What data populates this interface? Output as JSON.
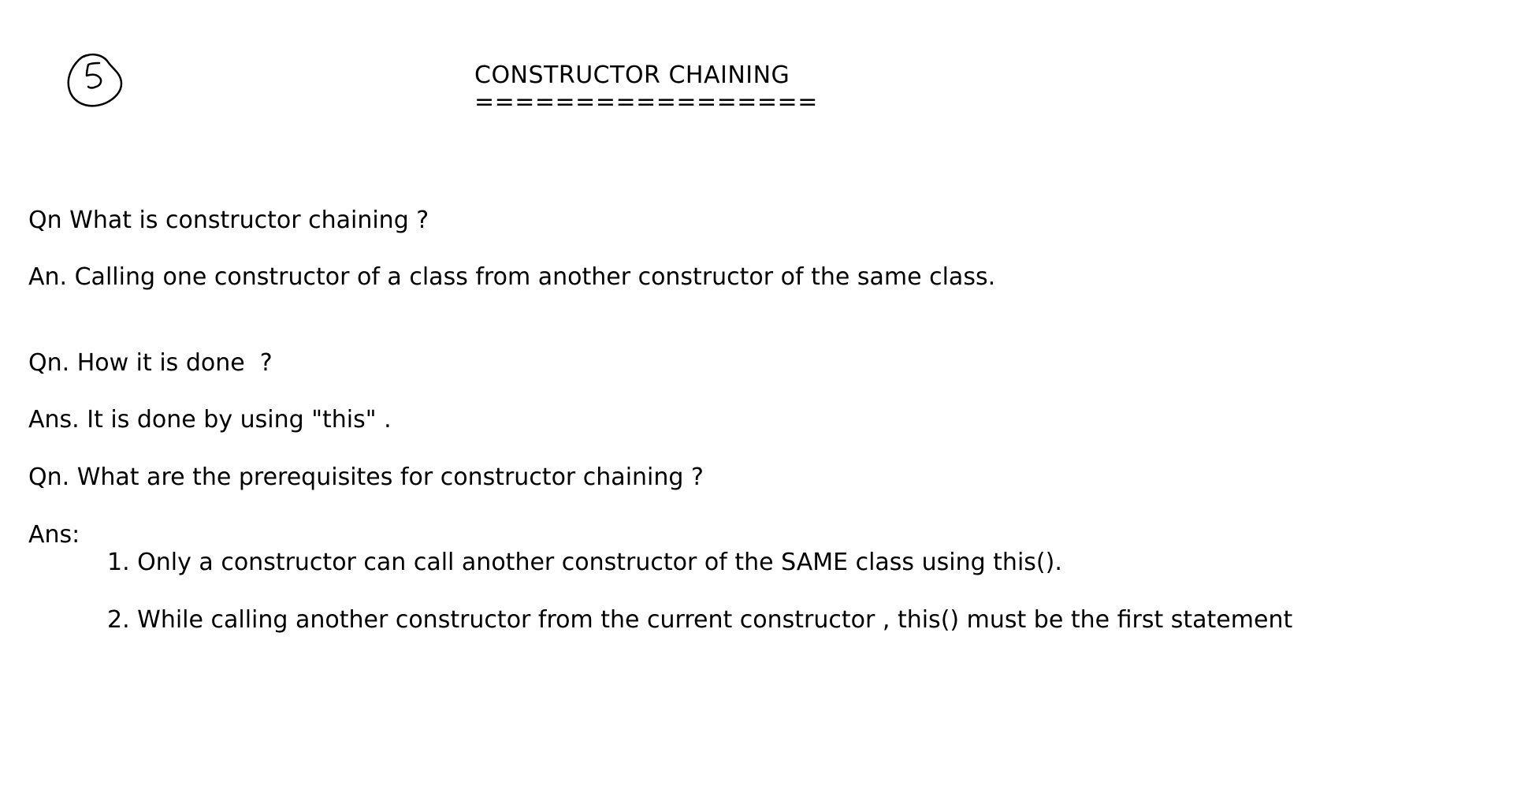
{
  "page_mark": "5",
  "title": "CONSTRUCTOR CHAINING",
  "title_underline": "=================",
  "content": {
    "q1": "Qn What is constructor chaining ?",
    "a1": "An. Calling one constructor of a class from another constructor of the same class.",
    "q2": "Qn. How it is done  ?",
    "a2": "Ans. It is done by using \"this\" .",
    "q3": "Qn. What are the prerequisites for constructor chaining ?",
    "a3_label": "Ans:",
    "a3_items": [
      "1. Only a constructor can call another constructor of the SAME class using this().",
      "2. While calling another constructor from the current constructor , this() must be the first statement"
    ]
  }
}
